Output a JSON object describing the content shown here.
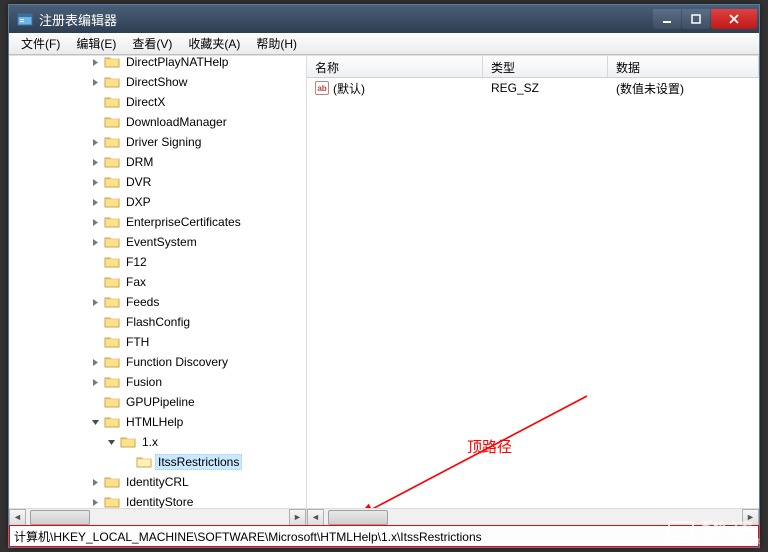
{
  "title": "注册表编辑器",
  "menus": [
    "文件(F)",
    "编辑(E)",
    "查看(V)",
    "收藏夹(A)",
    "帮助(H)"
  ],
  "tree": [
    {
      "depth": 5,
      "exp": "right",
      "label": "DirectPlayNATHelp"
    },
    {
      "depth": 5,
      "exp": "right",
      "label": "DirectShow"
    },
    {
      "depth": 5,
      "exp": "none",
      "label": "DirectX"
    },
    {
      "depth": 5,
      "exp": "none",
      "label": "DownloadManager"
    },
    {
      "depth": 5,
      "exp": "right",
      "label": "Driver Signing"
    },
    {
      "depth": 5,
      "exp": "right",
      "label": "DRM"
    },
    {
      "depth": 5,
      "exp": "right",
      "label": "DVR"
    },
    {
      "depth": 5,
      "exp": "right",
      "label": "DXP"
    },
    {
      "depth": 5,
      "exp": "right",
      "label": "EnterpriseCertificates"
    },
    {
      "depth": 5,
      "exp": "right",
      "label": "EventSystem"
    },
    {
      "depth": 5,
      "exp": "none",
      "label": "F12"
    },
    {
      "depth": 5,
      "exp": "none",
      "label": "Fax"
    },
    {
      "depth": 5,
      "exp": "right",
      "label": "Feeds"
    },
    {
      "depth": 5,
      "exp": "none",
      "label": "FlashConfig"
    },
    {
      "depth": 5,
      "exp": "none",
      "label": "FTH"
    },
    {
      "depth": 5,
      "exp": "right",
      "label": "Function Discovery"
    },
    {
      "depth": 5,
      "exp": "right",
      "label": "Fusion"
    },
    {
      "depth": 5,
      "exp": "none",
      "label": "GPUPipeline"
    },
    {
      "depth": 5,
      "exp": "down",
      "label": "HTMLHelp"
    },
    {
      "depth": 6,
      "exp": "down",
      "label": "1.x"
    },
    {
      "depth": 7,
      "exp": "none",
      "label": "ItssRestrictions",
      "selected": true
    },
    {
      "depth": 5,
      "exp": "right",
      "label": "IdentityCRL"
    },
    {
      "depth": 5,
      "exp": "right",
      "label": "IdentityStore"
    }
  ],
  "list": {
    "columns": [
      "名称",
      "类型",
      "数据"
    ],
    "rows": [
      {
        "name": "(默认)",
        "type": "REG_SZ",
        "data": "(数值未设置)"
      }
    ]
  },
  "annotation_label": "顶路径",
  "status_path": "计算机\\HKEY_LOCAL_MACHINE\\SOFTWARE\\Microsoft\\HTMLHelp\\1.x\\ItssRestrictions",
  "watermark": {
    "brand": "系统之家",
    "url": "xitongzhijia.net"
  }
}
